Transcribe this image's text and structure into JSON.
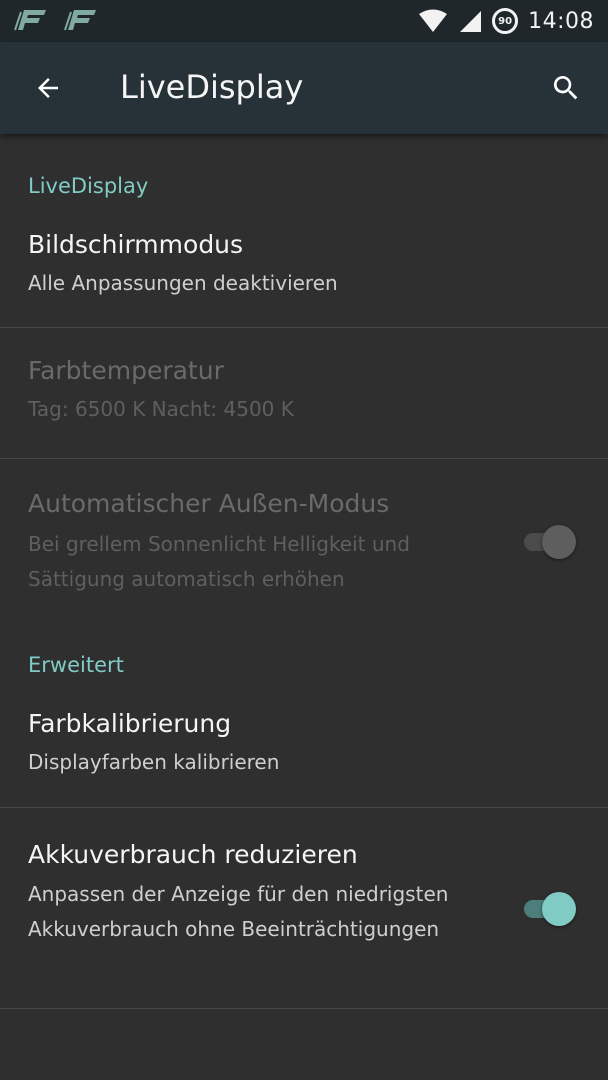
{
  "status_bar": {
    "time": "14:08",
    "battery_level": "90",
    "notification_icons": [
      "app-notification-icon",
      "app-notification-icon"
    ]
  },
  "app_bar": {
    "title": "LiveDisplay",
    "background": "#263238"
  },
  "sections": [
    {
      "header": "LiveDisplay",
      "items": [
        {
          "title": "Bildschirmmodus",
          "summary": "Alle Anpassungen deaktivieren",
          "enabled": true
        },
        {
          "title": "Farbtemperatur",
          "summary": "Tag: 6500 K Nacht: 4500 K",
          "enabled": false
        },
        {
          "title": "Automatischer Außen-Modus",
          "summary": "Bei grellem Sonnenlicht Helligkeit und Sättigung automatisch erhöhen",
          "enabled": false,
          "switch": "off"
        }
      ]
    },
    {
      "header": "Erweitert",
      "items": [
        {
          "title": "Farbkalibrierung",
          "summary": "Displayfarben kalibrieren",
          "enabled": true
        },
        {
          "title": "Akkuverbrauch reduzieren",
          "summary": "Anpassen der Anzeige für den niedrigsten Akkuverbrauch ohne Beeinträchtigungen",
          "enabled": true,
          "switch": "on"
        }
      ]
    }
  ],
  "colors": {
    "accent": "#80cbc4",
    "background": "#2f2f2f",
    "divider": "#474747"
  }
}
